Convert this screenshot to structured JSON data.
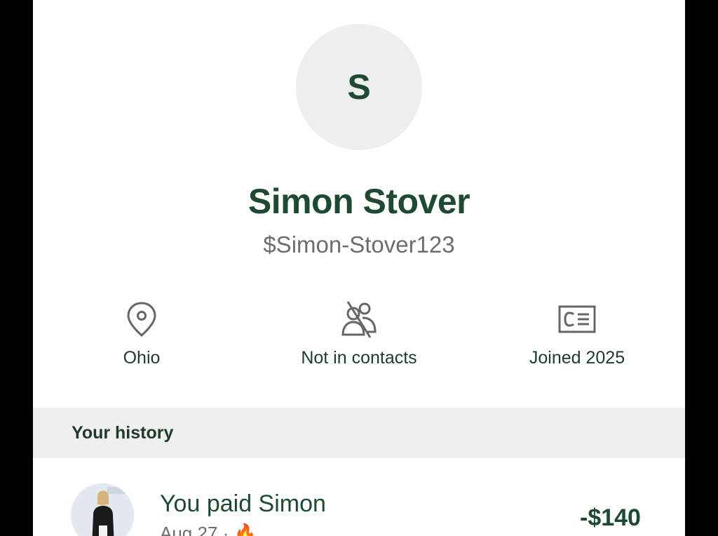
{
  "profile": {
    "initial": "S",
    "name": "Simon Stover",
    "handle": "$Simon-Stover123"
  },
  "info": {
    "location": {
      "label": "Ohio",
      "icon": "location-pin-icon"
    },
    "contacts": {
      "label": "Not in contacts",
      "icon": "not-in-contacts-icon"
    },
    "joined": {
      "label": "Joined 2025",
      "icon": "id-card-icon"
    }
  },
  "history": {
    "title": "Your history",
    "transactions": [
      {
        "title": "You paid Simon",
        "subtitle": "Aug 27 · 🔥",
        "amount": "-$140"
      }
    ]
  },
  "colors": {
    "brand_green": "#1e4a32",
    "secondary_gray": "#6d6d6d",
    "section_bg": "#efefef"
  }
}
